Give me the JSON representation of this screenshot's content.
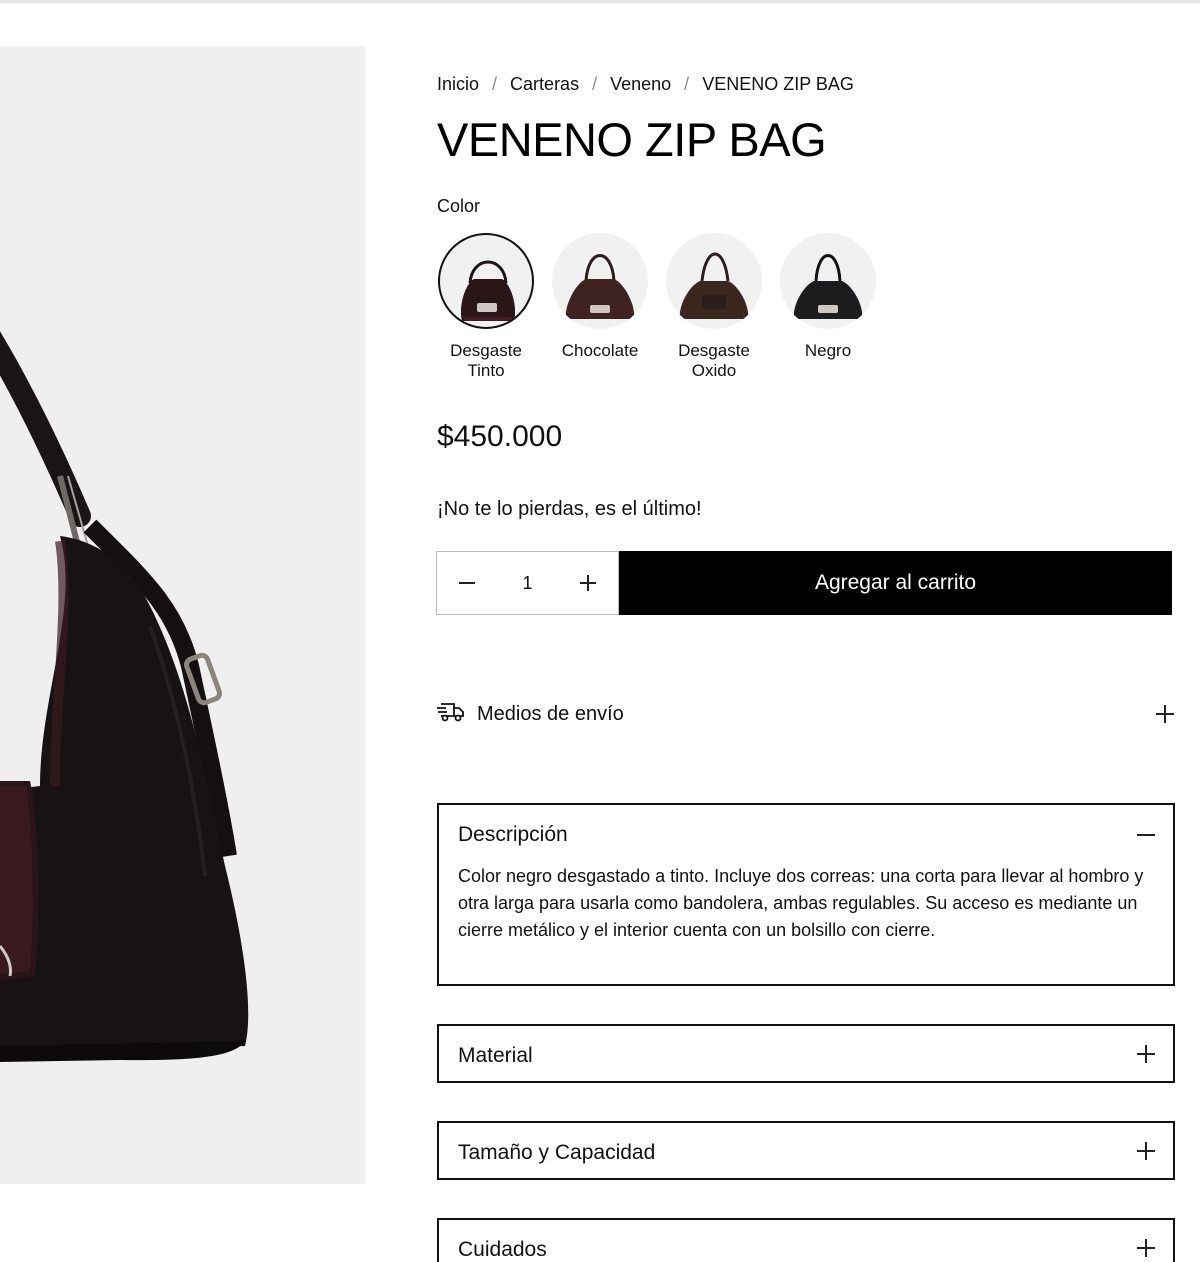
{
  "breadcrumb": {
    "items": [
      "Inicio",
      "Carteras",
      "Veneno",
      "VENENO ZIP BAG"
    ],
    "separator": "/"
  },
  "product": {
    "title": "VENENO ZIP BAG",
    "price": "$450.000",
    "stock_note": "¡No te lo pierdas, es el último!"
  },
  "color": {
    "label": "Color",
    "options": [
      {
        "name_line1": "Desgaste",
        "name_line2": "Tinto",
        "selected": true,
        "tone": "#3a1d22"
      },
      {
        "name_line1": "Chocolate",
        "name_line2": "",
        "selected": false,
        "tone": "#3d2220"
      },
      {
        "name_line1": "Desgaste",
        "name_line2": "Oxido",
        "selected": false,
        "tone": "#3b2620"
      },
      {
        "name_line1": "Negro",
        "name_line2": "",
        "selected": false,
        "tone": "#1c1c1e"
      }
    ]
  },
  "quantity": {
    "value": "1",
    "decrement_icon": "minus-icon",
    "increment_icon": "plus-icon"
  },
  "cart": {
    "button_label": "Agregar al carrito"
  },
  "shipping": {
    "label": "Medios de envío",
    "icon": "truck-icon"
  },
  "sections": {
    "description": {
      "title": "Descripción",
      "expanded": true,
      "text": "Color negro desgastado a tinto. Incluye dos correas: una corta para llevar al hombro y otra larga para usarla como bandolera, ambas regulables. Su acceso es mediante un cierre metálico y el interior cuenta con un bolsillo con cierre."
    },
    "material": {
      "title": "Material",
      "expanded": false
    },
    "size": {
      "title": "Tamaño y Capacidad",
      "expanded": false
    },
    "care": {
      "title": "Cuidados",
      "expanded": false
    }
  },
  "colors": {
    "accent": "#000000",
    "border": "#111111",
    "image_bg": "#efefef"
  }
}
